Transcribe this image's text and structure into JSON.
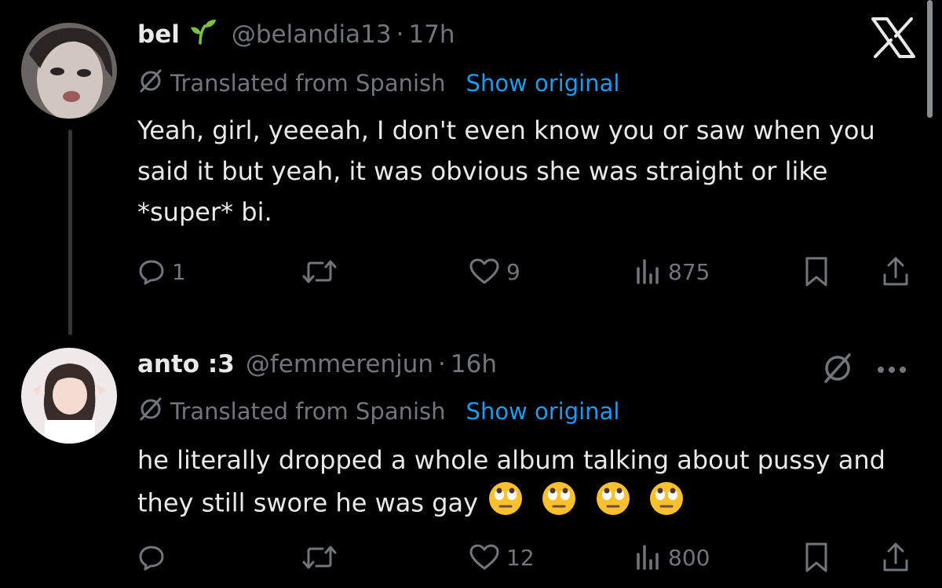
{
  "tweets": [
    {
      "name": "bel",
      "handle": "@belandia13",
      "separator": "·",
      "time": "17h",
      "translated_label": "Translated from Spanish",
      "show_original": "Show original",
      "text": "Yeah, girl, yeeeah, I don't even know you or saw when you said it but yeah, it was obvious she was straight or like *super* bi.",
      "replies": "1",
      "reposts": "",
      "likes": "9",
      "views": "875"
    },
    {
      "name": "anto :3",
      "handle": "@femmerenjun",
      "separator": "·",
      "time": "16h",
      "translated_label": "Translated from Spanish",
      "show_original": "Show original",
      "text": "he literally dropped a whole album talking about pussy and they still swore he was gay",
      "replies": "",
      "reposts": "",
      "likes": "12",
      "views": "800"
    }
  ],
  "icons": {
    "brand": "x-logo-icon",
    "reply": "reply-icon",
    "repost": "repost-icon",
    "like": "heart-icon",
    "views": "views-icon",
    "bookmark": "bookmark-icon",
    "share": "share-icon",
    "more": "more-icon",
    "translate": "translate-icon",
    "emoji": "eye-roll-emoji"
  },
  "colors": {
    "background": "#000000",
    "text": "#e7e9ea",
    "muted": "#71767b",
    "link": "#1d9bf0",
    "sprout": "#7cc242"
  }
}
